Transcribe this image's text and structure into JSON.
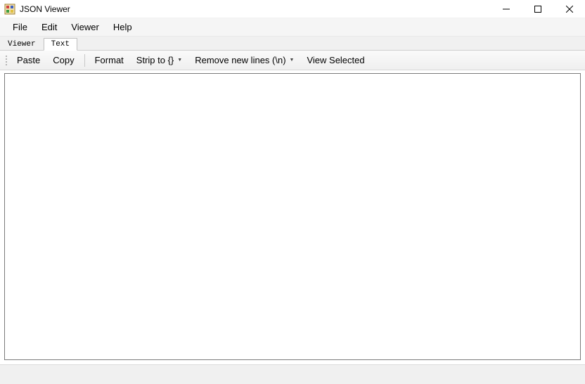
{
  "window": {
    "title": "JSON Viewer"
  },
  "menubar": {
    "items": [
      "File",
      "Edit",
      "Viewer",
      "Help"
    ]
  },
  "tabs": {
    "items": [
      {
        "label": "Viewer",
        "active": false
      },
      {
        "label": "Text",
        "active": true
      }
    ]
  },
  "toolbar": {
    "paste": "Paste",
    "copy": "Copy",
    "format": "Format",
    "strip_to": "Strip to {}",
    "remove_newlines": "Remove new lines (\\n)",
    "view_selected": "View Selected"
  },
  "editor": {
    "value": ""
  }
}
